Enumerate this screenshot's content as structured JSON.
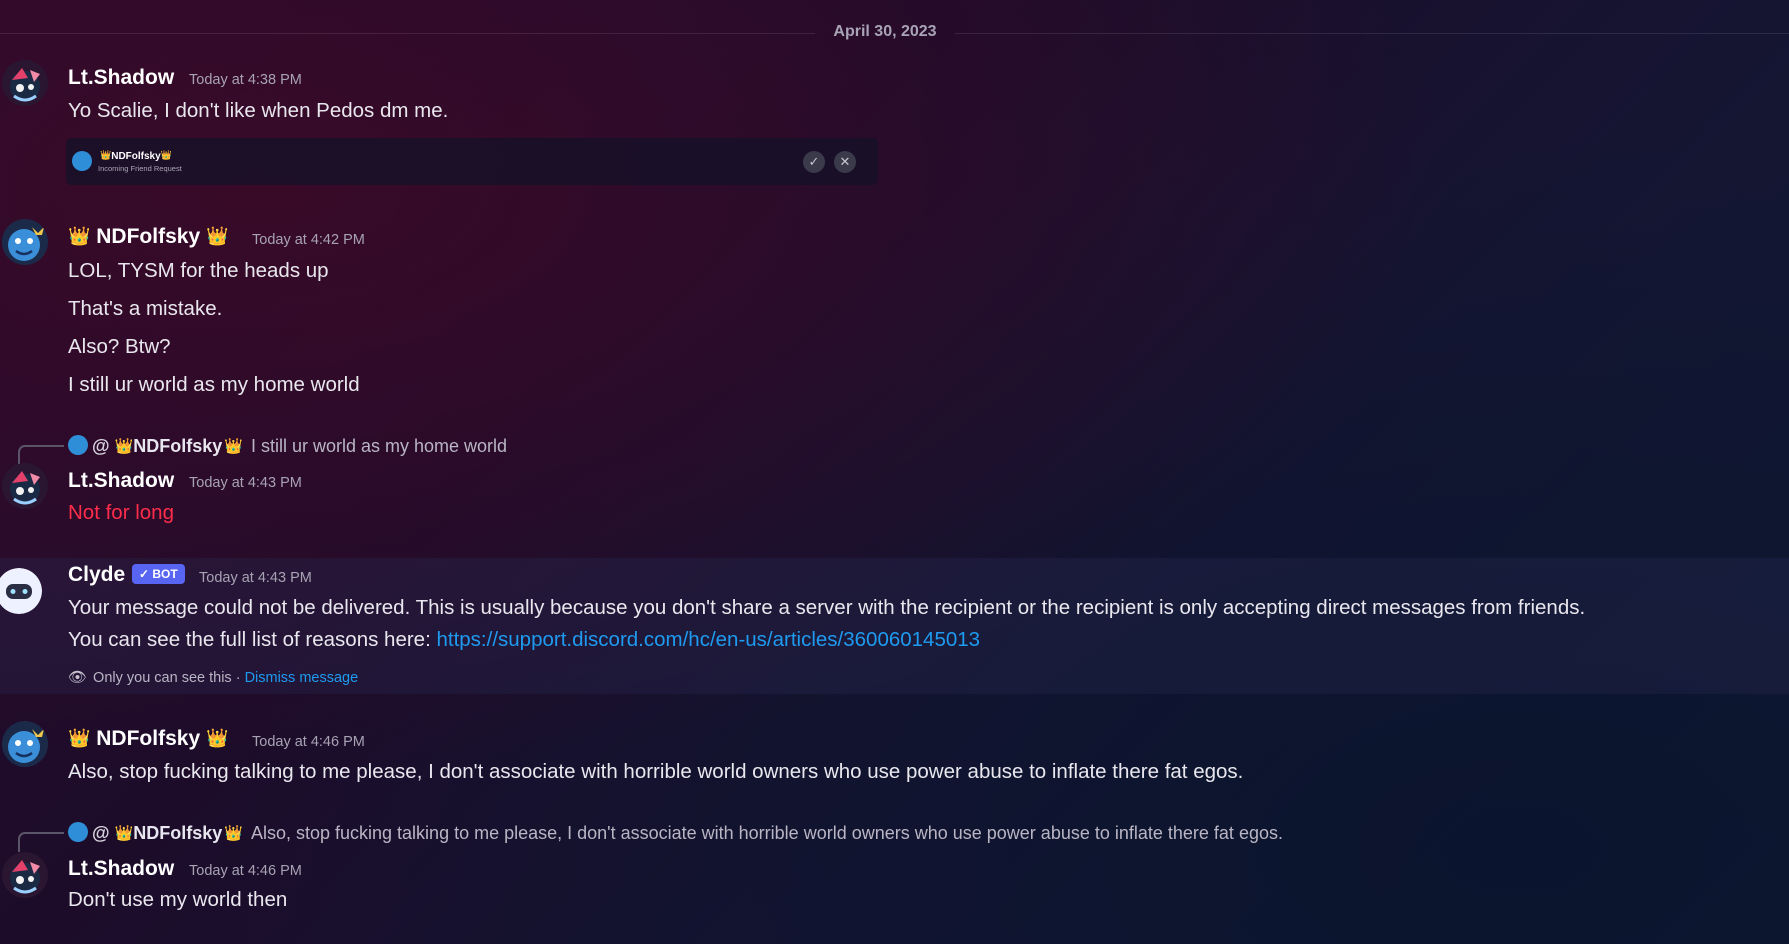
{
  "date_divider": "April 30, 2023",
  "accent_colors": {
    "link": "#1e9bf0",
    "bot_badge": "#5865f2",
    "danger_text": "#ff2d4a"
  },
  "messages": [
    {
      "author": "Lt.Shadow",
      "timestamp": "Today at 4:38 PM",
      "lines": [
        "Yo Scalie, I don't like when Pedos dm me."
      ],
      "embed": {
        "name": "NDFolfsky",
        "subtitle": "Incoming Friend Request",
        "accept_icon": "check-icon",
        "decline_icon": "close-icon"
      }
    },
    {
      "author": "NDFolfsky",
      "timestamp": "Today at 4:42 PM",
      "lines": [
        "LOL, TYSM for the heads up",
        "That's a mistake.",
        "Also? Btw?",
        "I still ur world as my home world"
      ]
    },
    {
      "reply": {
        "at": "@",
        "name": "NDFolfsky",
        "text": "I still ur world as my home world"
      },
      "author": "Lt.Shadow",
      "timestamp": "Today at 4:43 PM",
      "lines": [
        "Not for long"
      ]
    },
    {
      "author": "Clyde",
      "badge": "✓ BOT",
      "timestamp": "Today at 4:43 PM",
      "lines": [
        "Your message could not be delivered. This is usually because you don't share a server with the recipient or the recipient is only accepting direct messages from friends.",
        "You can see the full list of reasons here: "
      ],
      "link": "https://support.discord.com/hc/en-us/articles/360060145013",
      "ephemeral_note": "Only you can see this · ",
      "dismiss": "Dismiss message"
    },
    {
      "author": "NDFolfsky",
      "timestamp": "Today at 4:46 PM",
      "lines": [
        "Also, stop fucking talking to me please, I don't associate with horrible world owners who use power abuse to inflate there fat egos."
      ]
    },
    {
      "reply": {
        "at": "@",
        "name": "NDFolfsky",
        "text": "Also, stop fucking talking to me please, I don't associate with horrible world owners who use power abuse to inflate there fat egos."
      },
      "author": "Lt.Shadow",
      "timestamp": "Today at 4:46 PM",
      "lines": [
        "Don't use my world then"
      ]
    }
  ]
}
